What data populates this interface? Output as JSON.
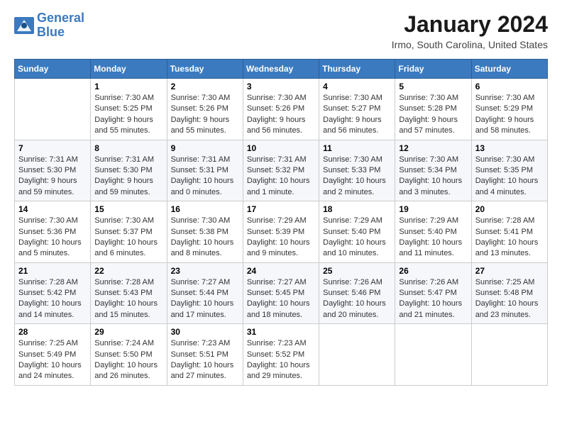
{
  "logo": {
    "line1": "General",
    "line2": "Blue"
  },
  "title": "January 2024",
  "location": "Irmo, South Carolina, United States",
  "days_header": [
    "Sunday",
    "Monday",
    "Tuesday",
    "Wednesday",
    "Thursday",
    "Friday",
    "Saturday"
  ],
  "weeks": [
    [
      {
        "day": "",
        "content": ""
      },
      {
        "day": "1",
        "content": "Sunrise: 7:30 AM\nSunset: 5:25 PM\nDaylight: 9 hours\nand 55 minutes."
      },
      {
        "day": "2",
        "content": "Sunrise: 7:30 AM\nSunset: 5:26 PM\nDaylight: 9 hours\nand 55 minutes."
      },
      {
        "day": "3",
        "content": "Sunrise: 7:30 AM\nSunset: 5:26 PM\nDaylight: 9 hours\nand 56 minutes."
      },
      {
        "day": "4",
        "content": "Sunrise: 7:30 AM\nSunset: 5:27 PM\nDaylight: 9 hours\nand 56 minutes."
      },
      {
        "day": "5",
        "content": "Sunrise: 7:30 AM\nSunset: 5:28 PM\nDaylight: 9 hours\nand 57 minutes."
      },
      {
        "day": "6",
        "content": "Sunrise: 7:30 AM\nSunset: 5:29 PM\nDaylight: 9 hours\nand 58 minutes."
      }
    ],
    [
      {
        "day": "7",
        "content": "Sunrise: 7:31 AM\nSunset: 5:30 PM\nDaylight: 9 hours\nand 59 minutes."
      },
      {
        "day": "8",
        "content": "Sunrise: 7:31 AM\nSunset: 5:30 PM\nDaylight: 9 hours\nand 59 minutes."
      },
      {
        "day": "9",
        "content": "Sunrise: 7:31 AM\nSunset: 5:31 PM\nDaylight: 10 hours\nand 0 minutes."
      },
      {
        "day": "10",
        "content": "Sunrise: 7:31 AM\nSunset: 5:32 PM\nDaylight: 10 hours\nand 1 minute."
      },
      {
        "day": "11",
        "content": "Sunrise: 7:30 AM\nSunset: 5:33 PM\nDaylight: 10 hours\nand 2 minutes."
      },
      {
        "day": "12",
        "content": "Sunrise: 7:30 AM\nSunset: 5:34 PM\nDaylight: 10 hours\nand 3 minutes."
      },
      {
        "day": "13",
        "content": "Sunrise: 7:30 AM\nSunset: 5:35 PM\nDaylight: 10 hours\nand 4 minutes."
      }
    ],
    [
      {
        "day": "14",
        "content": "Sunrise: 7:30 AM\nSunset: 5:36 PM\nDaylight: 10 hours\nand 5 minutes."
      },
      {
        "day": "15",
        "content": "Sunrise: 7:30 AM\nSunset: 5:37 PM\nDaylight: 10 hours\nand 6 minutes."
      },
      {
        "day": "16",
        "content": "Sunrise: 7:30 AM\nSunset: 5:38 PM\nDaylight: 10 hours\nand 8 minutes."
      },
      {
        "day": "17",
        "content": "Sunrise: 7:29 AM\nSunset: 5:39 PM\nDaylight: 10 hours\nand 9 minutes."
      },
      {
        "day": "18",
        "content": "Sunrise: 7:29 AM\nSunset: 5:40 PM\nDaylight: 10 hours\nand 10 minutes."
      },
      {
        "day": "19",
        "content": "Sunrise: 7:29 AM\nSunset: 5:40 PM\nDaylight: 10 hours\nand 11 minutes."
      },
      {
        "day": "20",
        "content": "Sunrise: 7:28 AM\nSunset: 5:41 PM\nDaylight: 10 hours\nand 13 minutes."
      }
    ],
    [
      {
        "day": "21",
        "content": "Sunrise: 7:28 AM\nSunset: 5:42 PM\nDaylight: 10 hours\nand 14 minutes."
      },
      {
        "day": "22",
        "content": "Sunrise: 7:28 AM\nSunset: 5:43 PM\nDaylight: 10 hours\nand 15 minutes."
      },
      {
        "day": "23",
        "content": "Sunrise: 7:27 AM\nSunset: 5:44 PM\nDaylight: 10 hours\nand 17 minutes."
      },
      {
        "day": "24",
        "content": "Sunrise: 7:27 AM\nSunset: 5:45 PM\nDaylight: 10 hours\nand 18 minutes."
      },
      {
        "day": "25",
        "content": "Sunrise: 7:26 AM\nSunset: 5:46 PM\nDaylight: 10 hours\nand 20 minutes."
      },
      {
        "day": "26",
        "content": "Sunrise: 7:26 AM\nSunset: 5:47 PM\nDaylight: 10 hours\nand 21 minutes."
      },
      {
        "day": "27",
        "content": "Sunrise: 7:25 AM\nSunset: 5:48 PM\nDaylight: 10 hours\nand 23 minutes."
      }
    ],
    [
      {
        "day": "28",
        "content": "Sunrise: 7:25 AM\nSunset: 5:49 PM\nDaylight: 10 hours\nand 24 minutes."
      },
      {
        "day": "29",
        "content": "Sunrise: 7:24 AM\nSunset: 5:50 PM\nDaylight: 10 hours\nand 26 minutes."
      },
      {
        "day": "30",
        "content": "Sunrise: 7:23 AM\nSunset: 5:51 PM\nDaylight: 10 hours\nand 27 minutes."
      },
      {
        "day": "31",
        "content": "Sunrise: 7:23 AM\nSunset: 5:52 PM\nDaylight: 10 hours\nand 29 minutes."
      },
      {
        "day": "",
        "content": ""
      },
      {
        "day": "",
        "content": ""
      },
      {
        "day": "",
        "content": ""
      }
    ]
  ]
}
